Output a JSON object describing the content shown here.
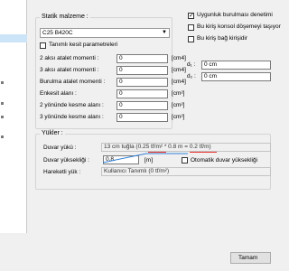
{
  "left_panel": {
    "items_count": 5
  },
  "static_material": {
    "title": "Statik malzeme :",
    "material_value": "C25 B420C",
    "custom_section_label": "Tanımlı kesit parametreleri",
    "custom_section_checked": false,
    "rows": [
      {
        "label": "2 aksı atalet momenti :",
        "value": "0",
        "unit": "[cm4]"
      },
      {
        "label": "3 aksı atalet momenti :",
        "value": "0",
        "unit": "[cm4]"
      },
      {
        "label": "Burulma atalet momenti :",
        "value": "0",
        "unit": "[cm4]"
      },
      {
        "label": "Enkesit alanı :",
        "value": "0",
        "unit": "[cm²]"
      },
      {
        "label": "2 yönünde kesme alanı :",
        "value": "0",
        "unit": "[cm²]"
      },
      {
        "label": "3 yönünde kesme alanı :",
        "value": "0",
        "unit": "[cm²]"
      }
    ]
  },
  "options": {
    "torsion_check": {
      "label": "Uygunluk burulması denetimi",
      "checked": true
    },
    "console_beam": {
      "label": "Bu kiriş konsol döşemeyi taşıyor",
      "checked": false
    },
    "tie_beam": {
      "label": "Bu kiriş bağ kirişidir",
      "checked": false
    }
  },
  "dims": {
    "d1_label": "d₁ :",
    "d1_value": "0 cm",
    "d2_label": "d₂ :",
    "d2_value": "0 cm"
  },
  "loads": {
    "title": "Yükler :",
    "wall_load_label": "Duvar yükü :",
    "wall_load_value": "13 cm tuğla (0.25 tf/m² * 0.8 m = 0.2 tf/m)",
    "wall_height_label": "Duvar yüksekliği :",
    "wall_height_value": "0.8",
    "wall_height_unit": "[m]",
    "auto_wall_height_label": "Otomatik duvar yüksekliği",
    "auto_wall_height_checked": false,
    "live_load_label": "Hareketli yük :",
    "live_load_value": "Kullanıcı Tanımlı (0 tf/m²)"
  },
  "footer": {
    "ok_label": "Tamam"
  },
  "colors": {
    "annotation_red": "#e8362b",
    "annotation_blue": "#2f7fd8"
  }
}
